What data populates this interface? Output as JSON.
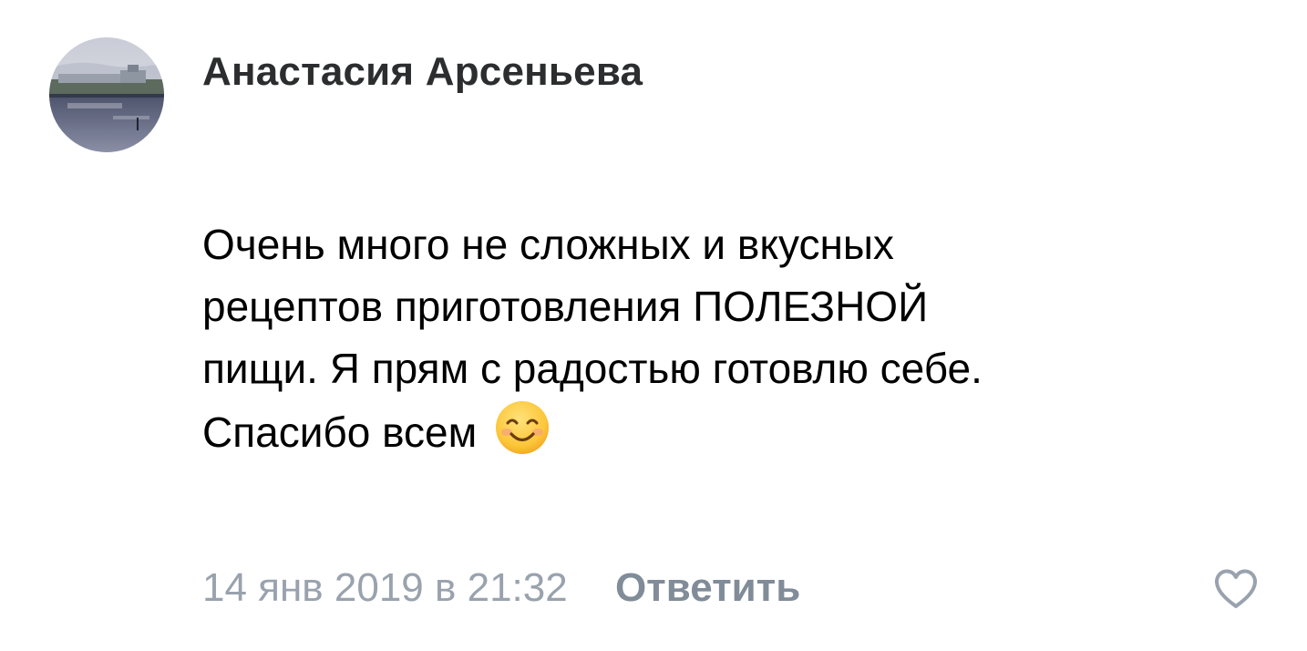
{
  "comment": {
    "author": "Анастасия Арсеньева",
    "text_lines": [
      "Очень много не сложных и вкусных",
      "рецептов приготовления ПОЛЕЗНОЙ",
      "пищи. Я прям с радостью готовлю себе.",
      "Спасибо всем"
    ],
    "emoji": "smiling-face-icon",
    "timestamp": "14 янв 2019 в 21:32",
    "reply_label": "Ответить",
    "like_icon": "heart-outline-icon"
  },
  "colors": {
    "author": "#2c2d2e",
    "text": "#000000",
    "timestamp": "#99a2ad",
    "reply": "#818c99",
    "like_icon": "#99a2ad"
  }
}
